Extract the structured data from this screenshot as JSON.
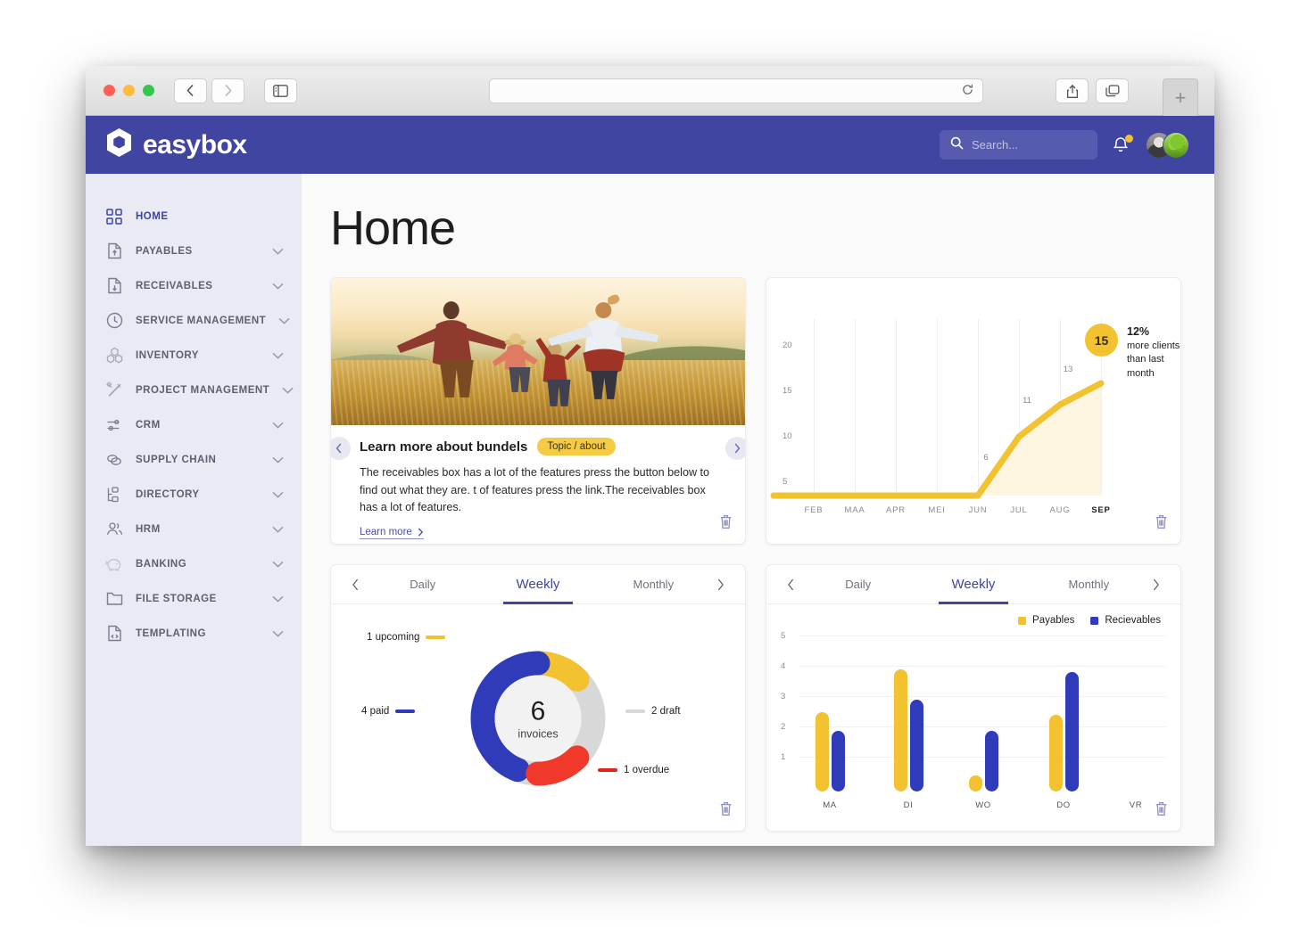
{
  "browser": {
    "back_icon": "chevron-left-icon",
    "forward_icon": "chevron-right-icon",
    "sidebar_icon": "sidebar-toggle-icon",
    "address_value": "",
    "address_placeholder": "",
    "reload_icon": "reload-icon",
    "share_icon": "share-icon",
    "tabs_icon": "tab-overview-icon",
    "new_tab_label": "+"
  },
  "header": {
    "brand": "easybox",
    "logo_icon": "hexagon-logo-icon",
    "search": {
      "placeholder": "Search...",
      "value": "",
      "icon": "search-icon"
    },
    "bell_icon": "bell-icon",
    "avatar_1": "avatar-person",
    "avatar_2": "avatar-tree"
  },
  "sidebar": {
    "items": [
      {
        "label": "HOME",
        "icon": "grid-icon",
        "active": true,
        "expandable": false
      },
      {
        "label": "PAYABLES",
        "icon": "document-up-icon",
        "active": false,
        "expandable": true
      },
      {
        "label": "RECEIVABLES",
        "icon": "document-down-icon",
        "active": false,
        "expandable": true
      },
      {
        "label": "SERVICE MANAGEMENT",
        "icon": "clock-icon",
        "active": false,
        "expandable": true
      },
      {
        "label": "INVENTORY",
        "icon": "boxes-icon",
        "active": false,
        "expandable": true
      },
      {
        "label": "PROJECT MANAGEMENT",
        "icon": "tools-icon",
        "active": false,
        "expandable": true
      },
      {
        "label": "CRM",
        "icon": "sliders-icon",
        "active": false,
        "expandable": true
      },
      {
        "label": "SUPPLY CHAIN",
        "icon": "links-icon",
        "active": false,
        "expandable": true
      },
      {
        "label": "DIRECTORY",
        "icon": "hierarchy-icon",
        "active": false,
        "expandable": true
      },
      {
        "label": "HRM",
        "icon": "people-icon",
        "active": false,
        "expandable": true
      },
      {
        "label": "BANKING",
        "icon": "piggy-bank-icon",
        "active": false,
        "expandable": true
      },
      {
        "label": "FILE STORAGE",
        "icon": "folder-icon",
        "active": false,
        "expandable": true
      },
      {
        "label": "TEMPLATING",
        "icon": "code-document-icon",
        "active": false,
        "expandable": true
      }
    ]
  },
  "main": {
    "page_title": "Home"
  },
  "bundles_card": {
    "title": "Learn more about bundels",
    "badge": "Topic / about",
    "body": "The receivables box has a lot of the features press the button below to find out what they are. t of features press the link.The receivables box has a lot of features.",
    "link": "Learn more",
    "prev_icon": "chevron-left-icon",
    "next_icon": "chevron-right-icon",
    "delete_icon": "trash-icon",
    "hero_alt": "family running in wheat field at sunset"
  },
  "line_card": {
    "badge_value": "15",
    "growth_pct": "12%",
    "growth_text": "more clients than last month",
    "delete_icon": "trash-icon"
  },
  "tabs": {
    "prev_icon": "chevron-left-icon",
    "next_icon": "chevron-right-icon",
    "items": [
      {
        "label": "Daily",
        "active": false
      },
      {
        "label": "Weekly",
        "active": true
      },
      {
        "label": "Monthly",
        "active": false
      }
    ]
  },
  "donut_card": {
    "center_number": "6",
    "center_unit": "invoices",
    "delete_icon": "trash-icon"
  },
  "bar_card": {
    "delete_icon": "trash-icon"
  },
  "colors": {
    "brand_blue": "#3F45A0",
    "sidebar_bg": "#E9EAF4",
    "accent_yellow": "#F2C230",
    "badge_yellow": "#F5CA45",
    "chart_blue": "#2F3BB8",
    "chart_red": "#F0382B",
    "chart_gray": "#D8D8D8",
    "bar_yellow": "#F2C230"
  },
  "chart_data": [
    {
      "type": "line",
      "id": "new-clients-line-chart",
      "title": "",
      "xlabel": "",
      "ylabel": "",
      "categories": [
        "FEB",
        "MAA",
        "APR",
        "MEI",
        "JUN",
        "JUL",
        "AUG",
        "SEP"
      ],
      "values": [
        0,
        0,
        0,
        0,
        6,
        11,
        13,
        15
      ],
      "point_labels": [
        "",
        "",
        "",
        "",
        "6",
        "11",
        "13",
        "15"
      ],
      "yticks": [
        5,
        10,
        15,
        20
      ],
      "ylim": [
        0,
        22
      ],
      "grid": "vertical",
      "legend": "none",
      "highlight": {
        "category": "SEP",
        "value": 15,
        "label": "12%",
        "note": "more clients than last month"
      },
      "series_color": "#F2C230",
      "area_fill": "#FDF5E0"
    },
    {
      "type": "pie",
      "id": "invoices-donut-chart",
      "title": "",
      "center_value": "6",
      "center_label": "invoices",
      "total": 8,
      "slices": [
        {
          "label": "1 upcoming",
          "value": 1,
          "color": "#F2C230"
        },
        {
          "label": "2 draft",
          "value": 2,
          "color": "#D8D8D8"
        },
        {
          "label": "1 overdue",
          "value": 1,
          "color": "#F0382B"
        },
        {
          "label": "4 paid",
          "value": 4,
          "color": "#2F3BB8"
        }
      ],
      "legend": "callout-labels"
    },
    {
      "type": "bar",
      "id": "payables-receivables-bar-chart",
      "title": "",
      "xlabel": "",
      "ylabel": "",
      "categories": [
        "MA",
        "DI",
        "WO",
        "DO",
        "VR"
      ],
      "yticks": [
        1,
        2,
        3,
        4,
        5
      ],
      "ylim": [
        0,
        5.4
      ],
      "grid": "horizontal",
      "legend": "top-right",
      "series": [
        {
          "name": "Payables",
          "color": "#F2C230",
          "values": [
            2.6,
            4.0,
            0.5,
            2.5,
            0
          ]
        },
        {
          "name": "Recievables",
          "color": "#2F3BB8",
          "values": [
            2.0,
            3.0,
            2.0,
            3.9,
            0
          ]
        }
      ]
    }
  ]
}
